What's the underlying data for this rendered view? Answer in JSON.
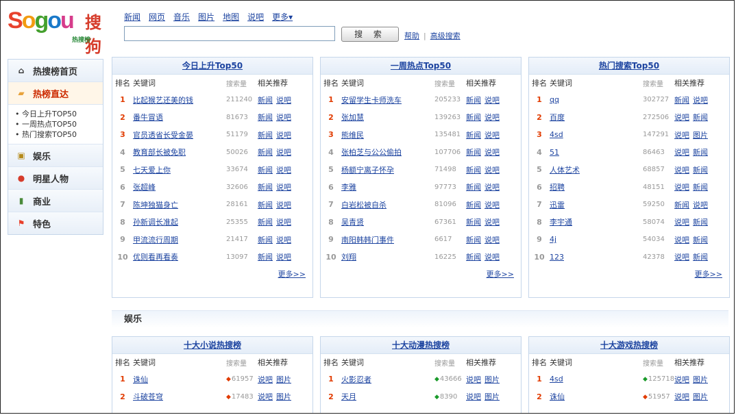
{
  "logo": {
    "brand": "Sogou",
    "cn": "搜狗",
    "sub": "热搜榜"
  },
  "topnav": [
    "新闻",
    "网页",
    "音乐",
    "图片",
    "地图",
    "说吧",
    "更多▾"
  ],
  "search": {
    "button": "搜 索",
    "help": "帮助",
    "sep": "|",
    "advanced": "高级搜索"
  },
  "sidebar": {
    "home": "热搜榜首页",
    "hot": "热榜直达",
    "sub": [
      "• 今日上升TOP50",
      "• 一周热点TOP50",
      "• 热门搜索TOP50"
    ],
    "cats": [
      "娱乐",
      "明星人物",
      "商业",
      "特色"
    ]
  },
  "headers": {
    "rank": "排名",
    "kw": "关键词",
    "num": "搜索量",
    "rel": "相关推荐"
  },
  "more": "更多>>",
  "panels": [
    {
      "title": "今日上升Top50",
      "rows": [
        [
          "1",
          "比起猴艺还美的钱",
          "211240",
          "新闻",
          "说吧"
        ],
        [
          "2",
          "番牛冒语",
          "81673",
          "新闻",
          "说吧"
        ],
        [
          "3",
          "官员透省长受金晏",
          "51179",
          "新闻",
          "说吧"
        ],
        [
          "4",
          "教育部长被免职",
          "50026",
          "新闻",
          "说吧"
        ],
        [
          "5",
          "七天爱上你",
          "33674",
          "新闻",
          "说吧"
        ],
        [
          "6",
          "张超峰",
          "32606",
          "新闻",
          "说吧"
        ],
        [
          "7",
          "陈坤独猫身亡",
          "28161",
          "新闻",
          "说吧"
        ],
        [
          "8",
          "孙新调长准起",
          "25355",
          "新闻",
          "说吧"
        ],
        [
          "9",
          "甲流流行周期",
          "21417",
          "新闻",
          "说吧"
        ],
        [
          "10",
          "优则看再看奏",
          "13097",
          "新闻",
          "说吧"
        ]
      ]
    },
    {
      "title": "一周热点Top50",
      "rows": [
        [
          "1",
          "安留学生卡师洗车",
          "205233",
          "新闻",
          "说吧"
        ],
        [
          "2",
          "张加慧",
          "139263",
          "新闻",
          "说吧"
        ],
        [
          "3",
          "熊维民",
          "135481",
          "新闻",
          "说吧"
        ],
        [
          "4",
          "张柏芝与公公偷拍",
          "107706",
          "新闻",
          "说吧"
        ],
        [
          "5",
          "杨额宁离子怀孕",
          "71498",
          "新闻",
          "说吧"
        ],
        [
          "6",
          "李雅",
          "97773",
          "新闻",
          "说吧"
        ],
        [
          "7",
          "白岩松被自杀",
          "81096",
          "新闻",
          "说吧"
        ],
        [
          "8",
          "吴青贤",
          "67361",
          "新闻",
          "说吧"
        ],
        [
          "9",
          "南阳韩韩门事件",
          "6617",
          "新闻",
          "说吧"
        ],
        [
          "10",
          "刘翔",
          "16225",
          "新闻",
          "说吧"
        ]
      ]
    },
    {
      "title": "热门搜索Top50",
      "rows": [
        [
          "1",
          "qq",
          "302727",
          "新闻",
          "说吧"
        ],
        [
          "2",
          "百度",
          "272506",
          "说吧",
          "新闻"
        ],
        [
          "3",
          "4sd",
          "147291",
          "说吧",
          "图片"
        ],
        [
          "4",
          "51",
          "86463",
          "说吧",
          "新闻"
        ],
        [
          "5",
          "人体艺术",
          "68857",
          "说吧",
          "新闻"
        ],
        [
          "6",
          "招聘",
          "48151",
          "说吧",
          "新闻"
        ],
        [
          "7",
          "迅雷",
          "59250",
          "新闻",
          "说吧"
        ],
        [
          "8",
          "李宇通",
          "58074",
          "说吧",
          "新闻"
        ],
        [
          "9",
          "4j",
          "54034",
          "说吧",
          "新闻"
        ],
        [
          "10",
          "123",
          "42378",
          "说吧",
          "新闻"
        ]
      ]
    }
  ],
  "section": "娱乐",
  "panels2": [
    {
      "title": "十大小说热搜榜",
      "rows": [
        [
          "1",
          "诛仙",
          "61957",
          "说吧",
          "图片"
        ],
        [
          "2",
          "斗破苍穹",
          "17483",
          "说吧",
          "图片"
        ]
      ]
    },
    {
      "title": "十大动漫热搜榜",
      "rows": [
        [
          "1",
          "火影忍者",
          "43666",
          "说吧",
          "图片"
        ],
        [
          "2",
          "天月",
          "8390",
          "说吧",
          "图片"
        ]
      ]
    },
    {
      "title": "十大游戏热搜榜",
      "rows": [
        [
          "1",
          "4sd",
          "125718",
          "说吧",
          "图片"
        ],
        [
          "2",
          "诛仙",
          "51957",
          "说吧",
          "图片"
        ]
      ]
    }
  ]
}
